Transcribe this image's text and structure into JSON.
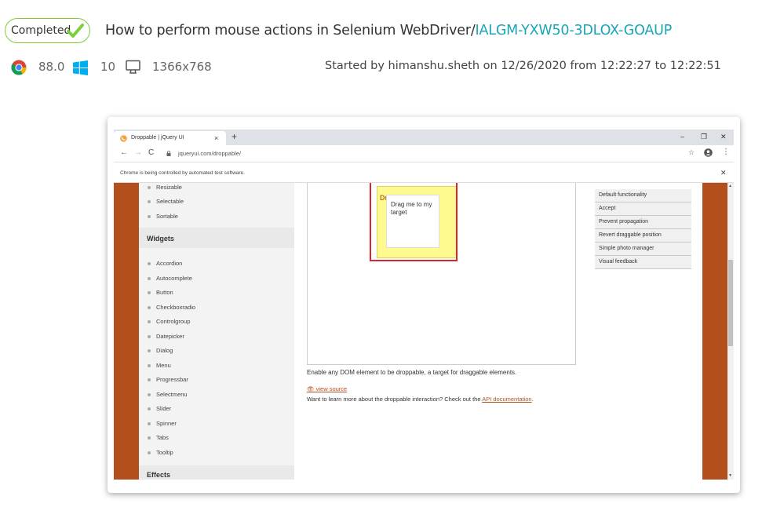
{
  "status": {
    "label": "Completed",
    "color": "#7ccf3a"
  },
  "test": {
    "title": "How to perform mouse actions in Selenium WebDriver/",
    "id": "IALGM-YXW50-3DLOX-GOAUP"
  },
  "environment": {
    "browser_icon": "chrome-icon",
    "browser_version": "88.0",
    "os_icon": "windows-icon",
    "os_version": "10",
    "resolution_icon": "monitor-icon",
    "resolution": "1366x768",
    "started": "Started by himanshu.sheth on 12/26/2020 from 12:22:27 to 12:22:51"
  },
  "browser": {
    "tab_title": "Droppable | jQuery UI",
    "tab_close": "×",
    "new_tab": "+",
    "minimize": "–",
    "restore": "❐",
    "close": "✕",
    "back": "←",
    "forward": "→",
    "reload": "C",
    "url": "jqueryui.com/droppable/",
    "star": "☆",
    "menu": "⋮",
    "infobar_text": "Chrome is being controlled by automated test software.",
    "infobar_close": "✕"
  },
  "sidebar": {
    "top_items": [
      "Resizable",
      "Selectable",
      "Sortable"
    ],
    "widgets_heading": "Widgets",
    "widgets": [
      "Accordion",
      "Autocomplete",
      "Button",
      "Checkboxradio",
      "Controlgroup",
      "Datepicker",
      "Dialog",
      "Menu",
      "Progressbar",
      "Selectmenu",
      "Slider",
      "Spinner",
      "Tabs",
      "Tooltip"
    ],
    "effects_heading": "Effects"
  },
  "demo": {
    "drop_label": "Dr",
    "drag_text": "Drag me to my target"
  },
  "content": {
    "description": "Enable any DOM element to be droppable, a target for draggable elements.",
    "view_source": "view source",
    "learn_more": "Want to learn more about the droppable interaction? Check out the ",
    "api_link": "API documentation",
    "learn_more_end": "."
  },
  "examples": [
    "Default functionality",
    "Accept",
    "Prevent propagation",
    "Revert draggable position",
    "Simple photo manager",
    "Visual feedback"
  ],
  "colors": {
    "accent": "#19a5b8",
    "jquery_brand": "#b24f1d",
    "highlight": "#d9262e",
    "droppable": "#fffa90"
  }
}
